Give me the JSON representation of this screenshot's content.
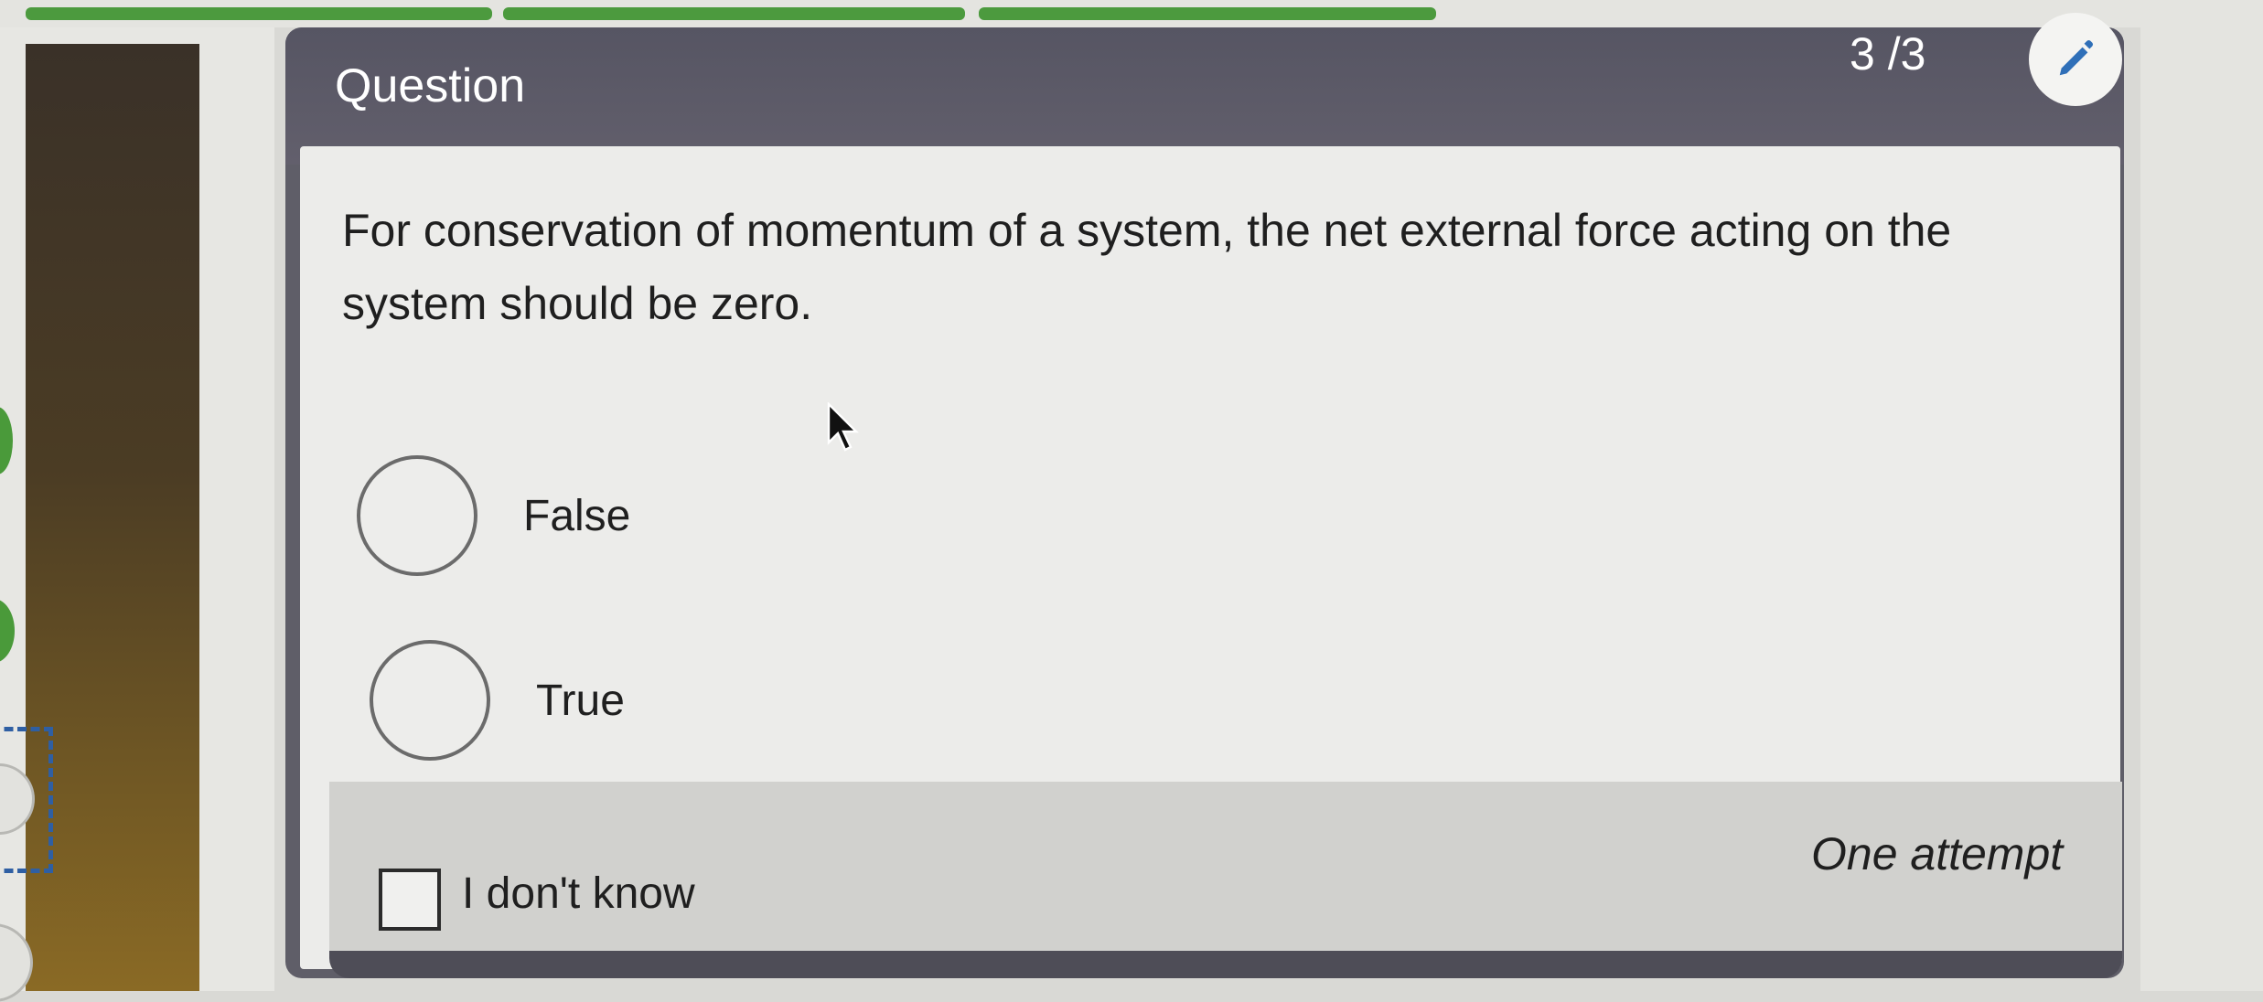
{
  "header": {
    "title": "Question",
    "counter": "3 /3",
    "edit_icon": "pencil-icon"
  },
  "question": {
    "text": "For conservation of momentum of a system, the net external force acting on the system should be zero."
  },
  "options": [
    {
      "label": "False",
      "selected": false
    },
    {
      "label": "True",
      "selected": false
    }
  ],
  "footer": {
    "dont_know_label": "I don't know",
    "dont_know_checked": false,
    "attempts_label": "One attempt"
  },
  "colors": {
    "header_bg": "#5f5e6b",
    "progress_green": "#4c9a3e",
    "body_bg": "#ececea",
    "footer_bg": "#d1d1ce"
  }
}
